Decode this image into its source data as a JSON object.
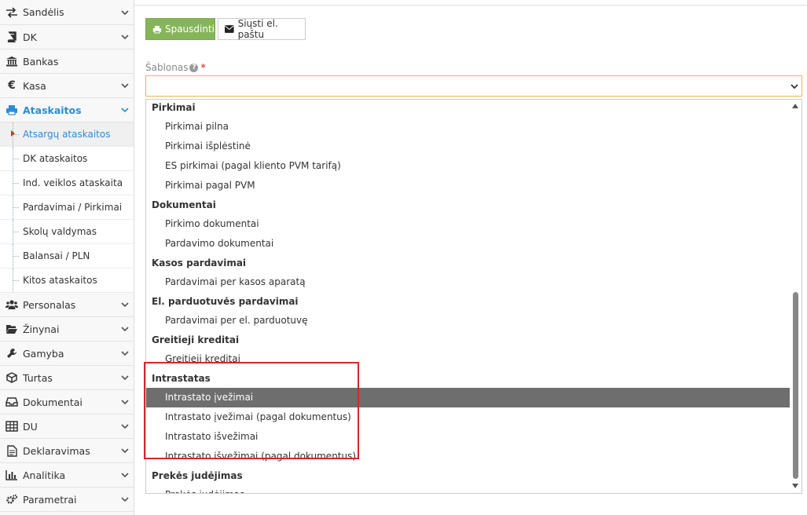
{
  "sidebar": {
    "items": [
      {
        "label": "Sandėlis",
        "icon": "exchange-arrows-icon"
      },
      {
        "label": "DK",
        "icon": "book-icon"
      },
      {
        "label": "Bankas",
        "icon": "bank-icon"
      },
      {
        "label": "Kasa",
        "icon": "euro-icon"
      },
      {
        "label": "Ataskaitos",
        "icon": "print-icon",
        "active": true
      },
      {
        "label": "Personalas",
        "icon": "users-icon"
      },
      {
        "label": "Žinynai",
        "icon": "folder-open-icon"
      },
      {
        "label": "Gamyba",
        "icon": "wrench-icon"
      },
      {
        "label": "Turtas",
        "icon": "cube-icon"
      },
      {
        "label": "Dokumentai",
        "icon": "inbox-icon"
      },
      {
        "label": "DU",
        "icon": "table-icon"
      },
      {
        "label": "Deklaravimas",
        "icon": "file-text-icon"
      },
      {
        "label": "Analitika",
        "icon": "bar-chart-icon"
      },
      {
        "label": "Parametrai",
        "icon": "gears-icon"
      }
    ],
    "subitems": [
      {
        "label": "Atsargų ataskaitos",
        "active": true
      },
      {
        "label": "DK ataskaitos"
      },
      {
        "label": "Ind. veiklos ataskaita"
      },
      {
        "label": "Pardavimai / Pirkimai"
      },
      {
        "label": "Skolų valdymas"
      },
      {
        "label": "Balansai / PLN"
      },
      {
        "label": "Kitos ataskaitos"
      }
    ]
  },
  "toolbar": {
    "print_label": "Spausdinti",
    "email_label": "Siųsti el. paštu",
    "print_color": "#86b559"
  },
  "form": {
    "template_label": "Šablonas",
    "help_mark": "?",
    "required_mark": "*",
    "selected_value": ""
  },
  "dropdown": {
    "groups": [
      {
        "label": "Pirkimai",
        "options": [
          "Pirkimai pilna",
          "Pirkimai išplėstinė",
          "ES pirkimai (pagal kliento PVM tarifą)",
          "Pirkimai pagal PVM"
        ]
      },
      {
        "label": "Dokumentai",
        "options": [
          "Pirkimo dokumentai",
          "Pardavimo dokumentai"
        ]
      },
      {
        "label": "Kasos pardavimai",
        "options": [
          "Pardavimai per kasos aparatą"
        ]
      },
      {
        "label": "El. parduotuvės pardavimai",
        "options": [
          "Pardavimai per el. parduotuvę"
        ]
      },
      {
        "label": "Greitieji kreditai",
        "options": [
          "Greitieji kreditai"
        ]
      },
      {
        "label": "Intrastatas",
        "options": [
          "Intrastato įvežimai",
          "Intrastato įvežimai (pagal dokumentus)",
          "Intrastato išvežimai",
          "Intrastato išvežimai (pagal dokumentus)"
        ]
      },
      {
        "label": "Prekės judėjimas",
        "options": [
          "Prekės judėjimas"
        ]
      }
    ],
    "highlighted_option": "Intrastato įvežimai",
    "highlight_color": "#6e6e6e",
    "annotation_color": "#d9252a"
  }
}
